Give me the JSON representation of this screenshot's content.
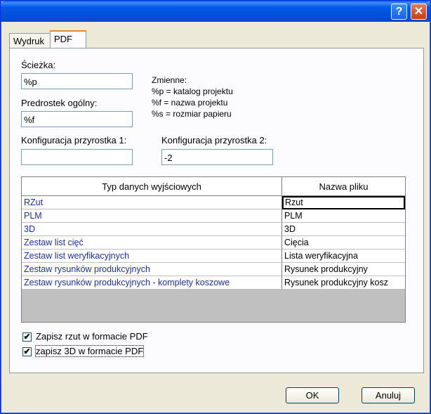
{
  "titlebar": {
    "help_label": "?",
    "close_label": "✕"
  },
  "tabs": [
    {
      "label": "Wydruk"
    },
    {
      "label": "PDF"
    }
  ],
  "form": {
    "path_label": "Ścieżka:",
    "path_value": "%p",
    "prefix_label": "Predrostek ogólny:",
    "prefix_value": "%f",
    "vars_title": "Zmienne:",
    "vars": [
      "%p = katalog projektu",
      "%f = nazwa projektu",
      "%s = rozmiar papieru"
    ],
    "cfg1_label": "Konfiguracja przyrostka 1:",
    "cfg1_value": "",
    "cfg2_label": "Konfiguracja przyrostka 2:",
    "cfg2_value": "-2"
  },
  "grid": {
    "columns": [
      "Typ danych wyjściowych",
      "Nazwa pliku"
    ],
    "rows": [
      {
        "type": "RZut",
        "file": "Rzut"
      },
      {
        "type": "PLM",
        "file": "PLM"
      },
      {
        "type": "3D",
        "file": "3D"
      },
      {
        "type": "Zestaw list cięć",
        "file": "Cięcia"
      },
      {
        "type": "Zestaw list weryfikacyjnych",
        "file": "Lista weryfikacyjna"
      },
      {
        "type": "Zestaw rysunków produkcyjnych",
        "file": "Rysunek produkcyjny"
      },
      {
        "type": "Zestaw rysunków produkcyjnych - komplety koszowe",
        "file": "Rysunek produkcyjny kosz"
      }
    ]
  },
  "options": [
    {
      "label": "Zapisz rzut w formacie PDF",
      "checked_mark": "✔"
    },
    {
      "label": "zapisz 3D w formacie PDF",
      "checked_mark": "✔"
    }
  ],
  "buttons": {
    "ok": "OK",
    "cancel": "Anuluj"
  }
}
